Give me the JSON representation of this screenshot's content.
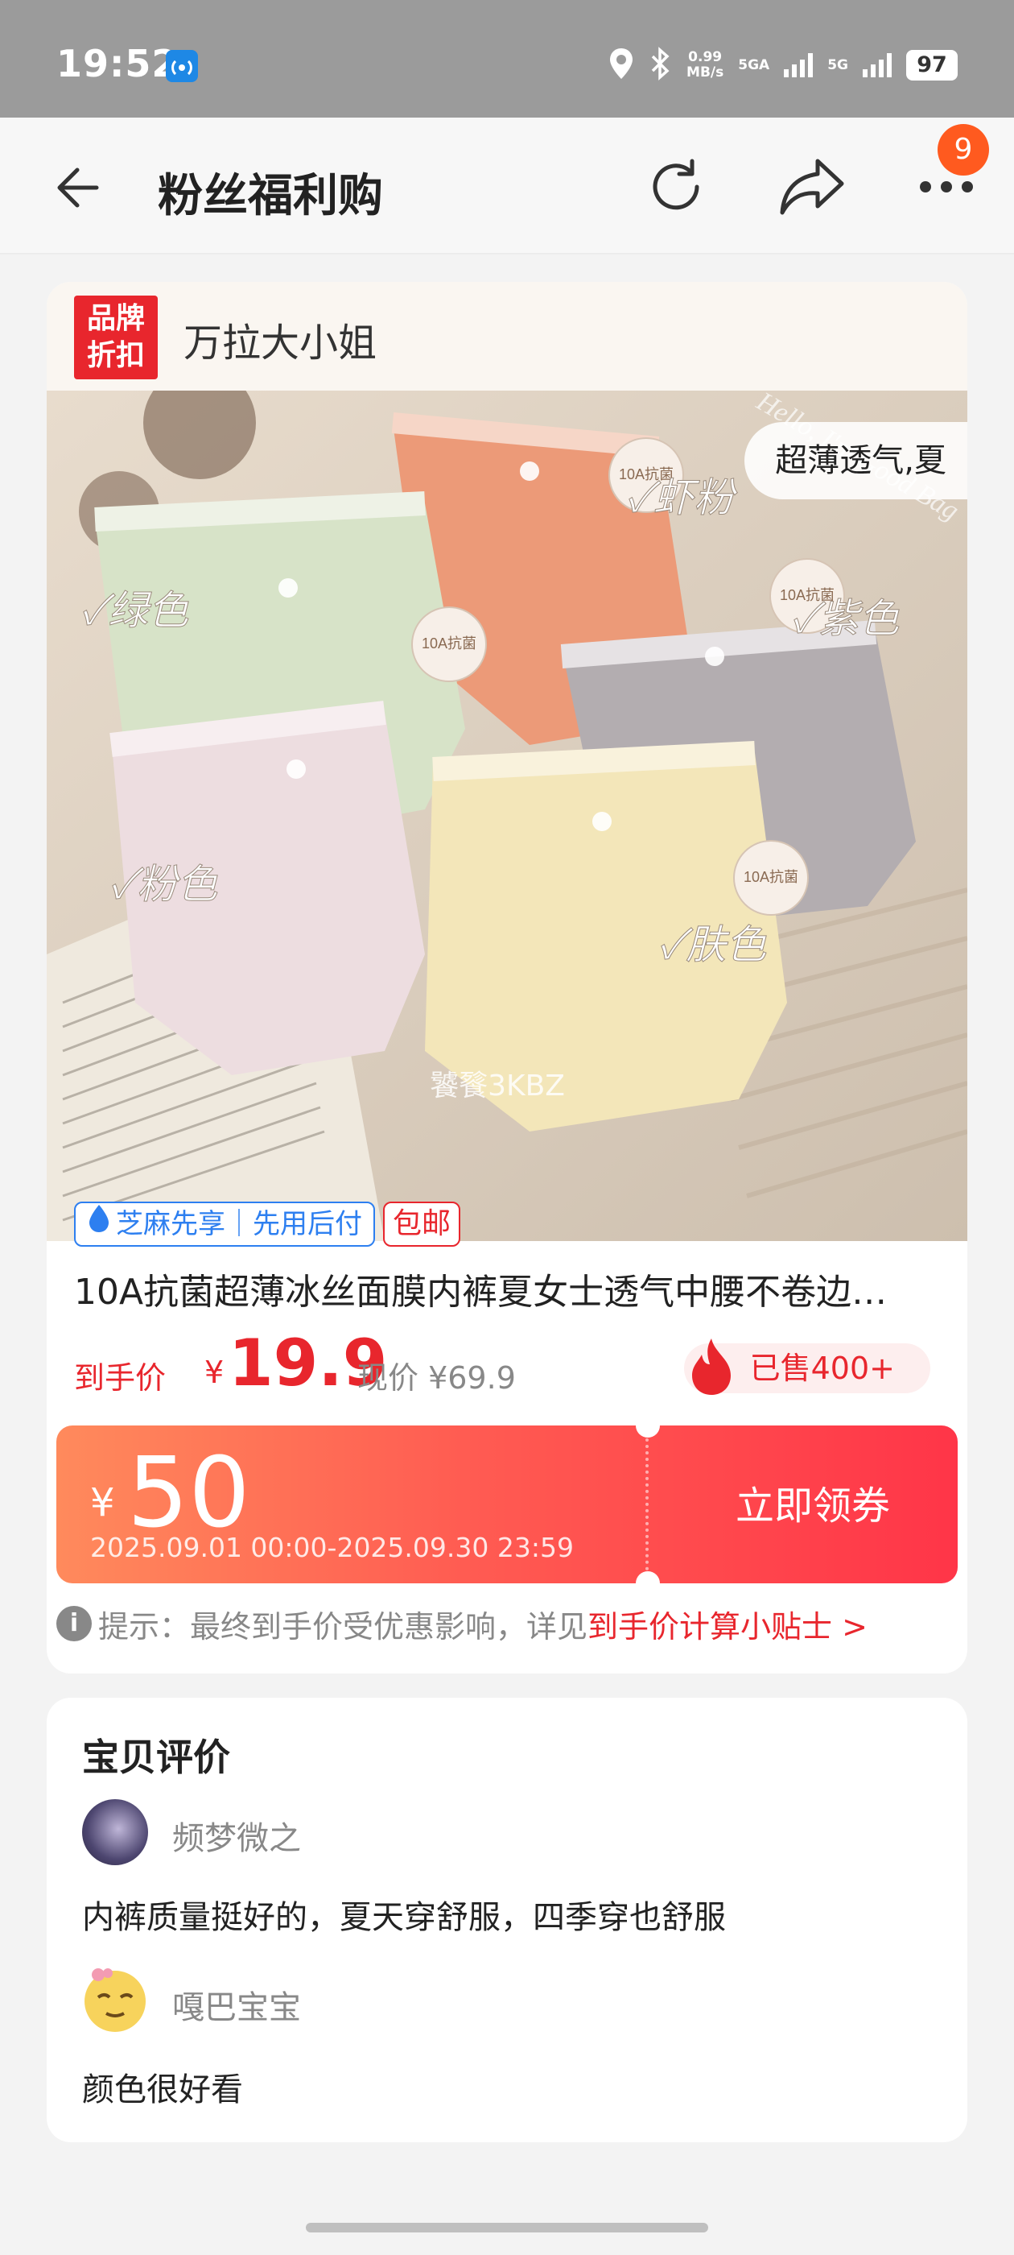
{
  "status_bar": {
    "time": "19:52",
    "speed_value": "0.99",
    "speed_unit": "MB/s",
    "net1": "5GA",
    "net2": "5G",
    "battery": "97"
  },
  "nav": {
    "title": "粉丝福利购",
    "more_count": "9"
  },
  "product": {
    "brand_badge_line1": "品牌",
    "brand_badge_line2": "折扣",
    "store_name": "万拉大小姐",
    "image_pill": "超薄透气,夏",
    "color_labels": [
      "✓虾粉",
      "✓绿色",
      "✓紫色",
      "✓粉色",
      "✓肤色"
    ],
    "image_tag": "10A抗菌",
    "photo_text": "Hello, I'm Good Bag",
    "watermark": "饕餮3KBZ",
    "tag_zhima": "芝麻先享｜先用后付",
    "tag_free_shipping": "包邮",
    "title": "10A抗菌超薄冰丝面膜内裤夏女士透气中腰不卷边…",
    "price_label": "到手价",
    "currency": "¥",
    "price": "19.9",
    "original_price": "现价 ¥69.9",
    "sold": "已售400+"
  },
  "coupon": {
    "currency": "¥",
    "amount": "50",
    "validity": "2025.09.01 00:00-2025.09.30 23:59",
    "button": "立即领券"
  },
  "tip": {
    "text": "提示：最终到手价受优惠影响，详见",
    "link": "到手价计算小贴士 >"
  },
  "reviews": {
    "title": "宝贝评价",
    "items": [
      {
        "user": "频梦微之",
        "text": "内裤质量挺好的，夏天穿舒服，四季穿也舒服"
      },
      {
        "user": "嘎巴宝宝",
        "text": "颜色很好看"
      }
    ]
  },
  "colors": {
    "accent_red": "#e8262d",
    "coupon_start": "#ff8a5c",
    "coupon_end": "#ff3548",
    "link_blue": "#2d7ff0",
    "badge_orange": "#ff5a1f"
  }
}
